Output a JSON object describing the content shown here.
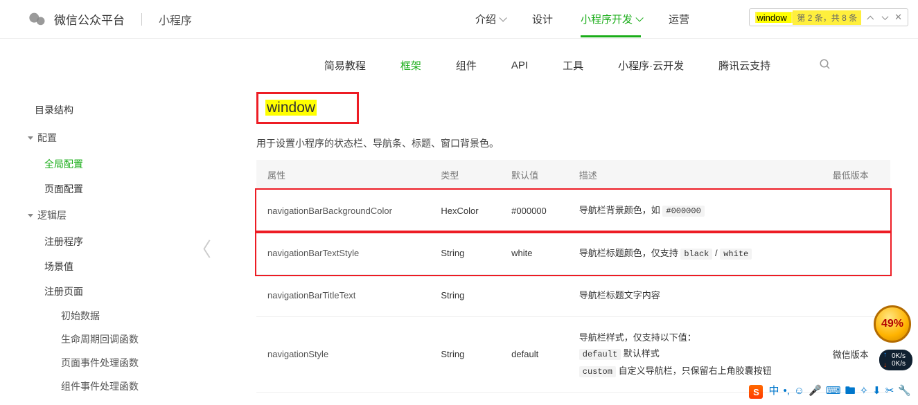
{
  "header": {
    "brand": "微信公众平台",
    "brand_sub": "小程序",
    "nav": [
      {
        "label": "介绍",
        "caret": true
      },
      {
        "label": "设计"
      },
      {
        "label": "小程序开发",
        "caret": true,
        "active": true
      },
      {
        "label": "运营"
      }
    ]
  },
  "search": {
    "query": "window",
    "status": "第 2 条，共 8 条"
  },
  "subnav": {
    "items": [
      "简易教程",
      "框架",
      "组件",
      "API",
      "工具",
      "小程序·云开发",
      "腾讯云支持"
    ],
    "active_index": 1
  },
  "sidebar": [
    {
      "type": "item",
      "label": "目录结构"
    },
    {
      "type": "group",
      "label": "配置",
      "children": [
        {
          "label": "全局配置",
          "active": true
        },
        {
          "label": "页面配置"
        }
      ]
    },
    {
      "type": "group",
      "label": "逻辑层",
      "children": [
        {
          "label": "注册程序"
        },
        {
          "label": "场景值"
        },
        {
          "label": "注册页面",
          "children": [
            {
              "label": "初始数据"
            },
            {
              "label": "生命周期回调函数"
            },
            {
              "label": "页面事件处理函数"
            },
            {
              "label": "组件事件处理函数"
            }
          ]
        }
      ]
    }
  ],
  "page": {
    "heading": "window",
    "description": "用于设置小程序的状态栏、导航条、标题、窗口背景色。",
    "columns": [
      "属性",
      "类型",
      "默认值",
      "描述",
      "最低版本"
    ],
    "rows": [
      {
        "prop": "navigationBarBackgroundColor",
        "type": "HexColor",
        "default": "#000000",
        "desc_parts": [
          {
            "t": "导航栏背景颜色，如 "
          },
          {
            "c": "#000000"
          }
        ],
        "min": "",
        "highlight": true
      },
      {
        "prop": "navigationBarTextStyle",
        "type": "String",
        "default": "white",
        "desc_parts": [
          {
            "t": "导航栏标题颜色，仅支持 "
          },
          {
            "c": "black"
          },
          {
            "t": " / "
          },
          {
            "c": "white"
          }
        ],
        "min": "",
        "highlight": true
      },
      {
        "prop": "navigationBarTitleText",
        "type": "String",
        "default": "",
        "desc_parts": [
          {
            "t": "导航栏标题文字内容"
          }
        ],
        "min": ""
      },
      {
        "prop": "navigationStyle",
        "type": "String",
        "default": "default",
        "desc_parts": [
          {
            "t": "导航栏样式，仅支持以下值："
          },
          {
            "br": true
          },
          {
            "c": "default"
          },
          {
            "t": " 默认样式"
          },
          {
            "br": true
          },
          {
            "c": "custom"
          },
          {
            "t": " 自定义导航栏，只保留右上角胶囊按钮"
          }
        ],
        "min": "微信版本"
      }
    ]
  },
  "widgets": {
    "speed_up": "0K/s",
    "speed_dn": "0K/s",
    "coin": "49%"
  },
  "ime": {
    "items": [
      "中",
      "•,",
      "☺",
      "🎤",
      "⌨",
      "🖿",
      "✧",
      "⬇",
      "✂",
      "🔧"
    ]
  }
}
